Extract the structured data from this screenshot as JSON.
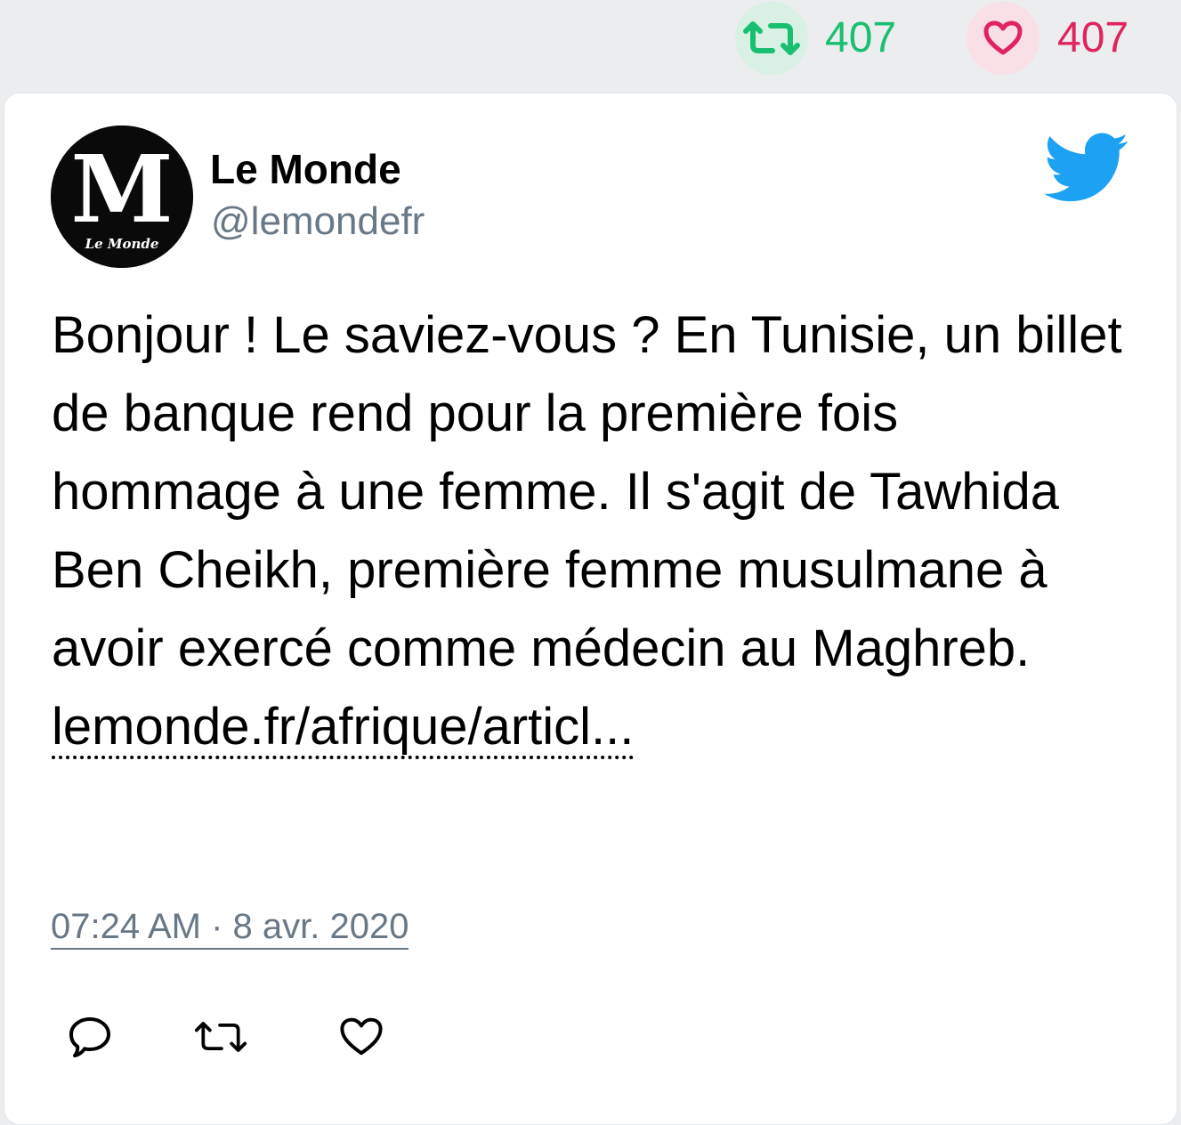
{
  "top_stats": {
    "retweet_count": "407",
    "like_count": "407",
    "retweet_color": "#19bf70",
    "like_color": "#e0245e",
    "retweet_icon": "retweet-icon",
    "like_icon": "heart-icon"
  },
  "tweet": {
    "author_name": "Le Monde",
    "author_handle": "@lemondefr",
    "avatar_label": "Le Monde",
    "avatar_icon": "le-monde-logo",
    "platform_icon": "twitter-bird-icon",
    "text": "Bonjour ! Le saviez-vous ? En Tunisie, un billet de banque rend pour la première fois hommage à une femme. Il s'agit de Tawhida Ben Cheikh, première femme musulmane à avoir exercé comme médecin au Maghreb.",
    "link_text": "lemonde.fr/afrique/articl...",
    "timestamp": "07:24 AM · 8 avr. 2020"
  },
  "actions": {
    "reply_icon": "reply-icon",
    "retweet_icon": "retweet-icon",
    "like_icon": "heart-icon"
  },
  "colors": {
    "twitter_blue": "#1da1f2",
    "muted_text": "#697886"
  }
}
